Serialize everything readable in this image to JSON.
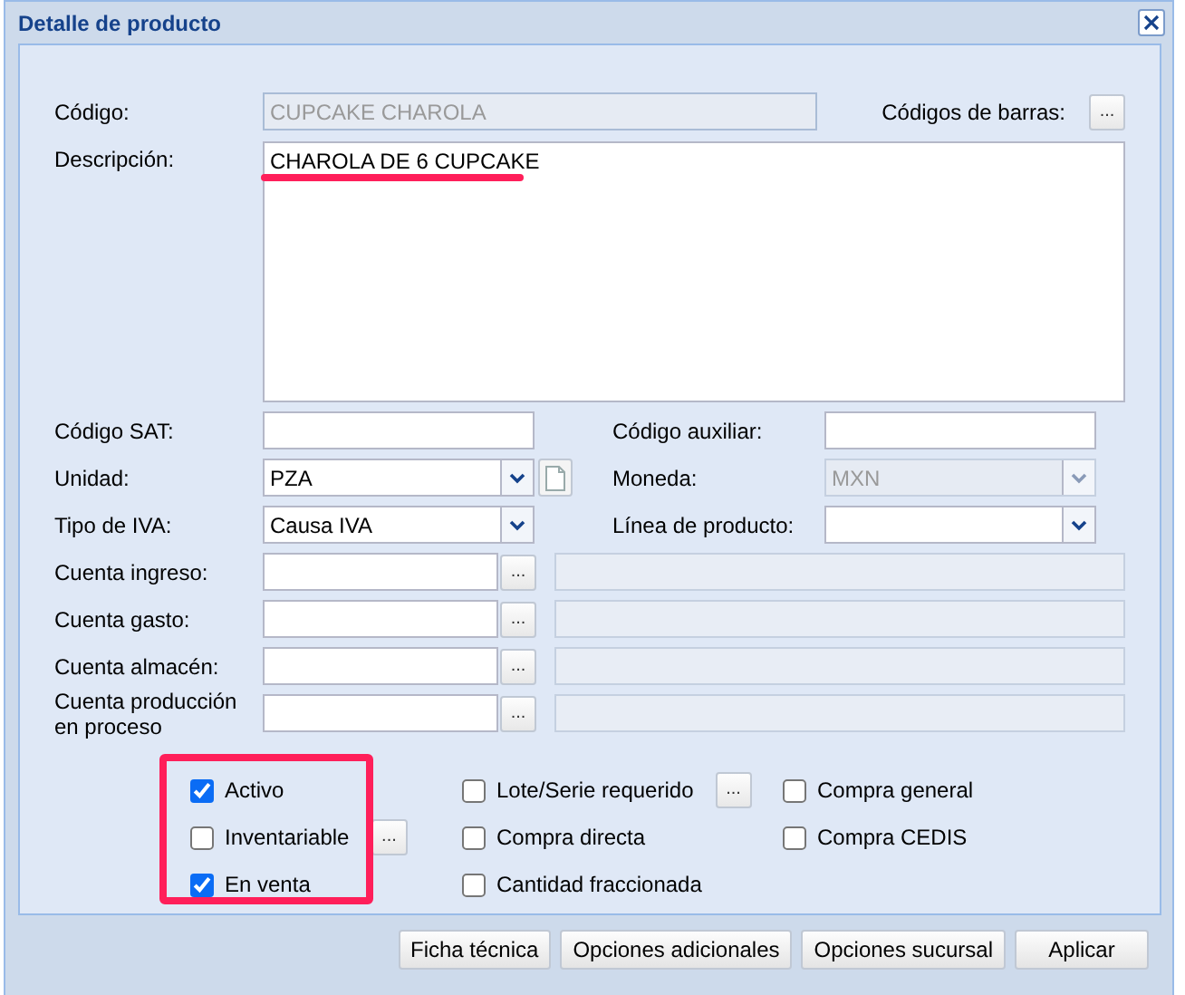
{
  "window": {
    "title": "Detalle de producto"
  },
  "rows": [
    {
      "kind": "code",
      "label": "Código:",
      "value": "CUPCAKE CHAROLA",
      "disabled": true,
      "extra_label": "Códigos de barras:",
      "button": "..."
    },
    {
      "kind": "textarea",
      "label": "Descripción:",
      "value": "CHAROLA DE 6 CUPCAKE",
      "underline": {
        "color": "#ff1f5a"
      }
    },
    {
      "kind": "pair",
      "left": {
        "label": "Código SAT:",
        "kind": "text"
      },
      "right": {
        "label": "Código auxiliar:",
        "kind": "text"
      }
    },
    {
      "kind": "pair",
      "left": {
        "label": "Unidad:",
        "kind": "select",
        "value": "PZA",
        "disabled": false,
        "new_button": true
      },
      "right": {
        "label": "Moneda:",
        "kind": "select",
        "value": "MXN",
        "disabled": true
      }
    },
    {
      "kind": "pair",
      "left": {
        "label": "Tipo de IVA:",
        "kind": "select",
        "value": "Causa IVA",
        "disabled": false
      },
      "right": {
        "label": "Línea de producto:",
        "kind": "select",
        "disabled": false
      }
    },
    {
      "kind": "account",
      "label": "Cuenta ingreso:",
      "button": "..."
    },
    {
      "kind": "account",
      "label": "Cuenta gasto:",
      "button": "..."
    },
    {
      "kind": "account",
      "label": "Cuenta almacén:",
      "button": "..."
    },
    {
      "kind": "account",
      "label": "Cuenta producción en proceso",
      "button": "..."
    }
  ],
  "checks": [
    [
      {
        "label": "Activo",
        "checked": true
      },
      {
        "label": "Inventariable",
        "checked": false,
        "button": "..."
      },
      {
        "label": "En venta",
        "checked": true
      }
    ],
    [
      {
        "label": "Lote/Serie requerido",
        "checked": false,
        "button": "..."
      },
      {
        "label": "Compra directa",
        "checked": false
      },
      {
        "label": "Cantidad fraccionada",
        "checked": false
      }
    ],
    [
      {
        "label": "Compra general",
        "checked": false
      },
      {
        "label": "Compra CEDIS",
        "checked": false
      }
    ]
  ],
  "checks_highlight": {
    "color": "#ff1f5a"
  },
  "buttons": [
    "Ficha técnica",
    "Opciones adicionales",
    "Opciones sucursal",
    "Aplicar"
  ]
}
